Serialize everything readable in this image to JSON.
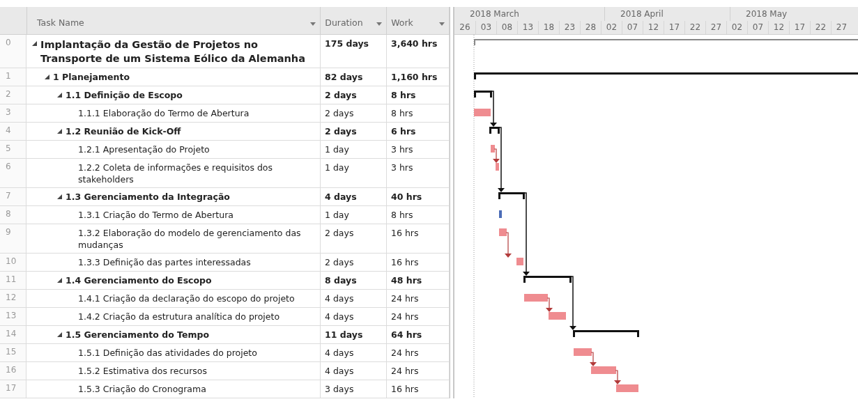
{
  "columns": [
    {
      "label": "Task Name"
    },
    {
      "label": "Duration"
    },
    {
      "label": "Work"
    }
  ],
  "timescale": {
    "months": [
      "2018 March",
      "2018 April",
      "2018 May"
    ],
    "days": [
      "26",
      "03",
      "08",
      "13",
      "18",
      "23",
      "28",
      "02",
      "07",
      "12",
      "17",
      "22",
      "27",
      "02",
      "07",
      "12",
      "17",
      "22",
      "27"
    ]
  },
  "tasks": [
    {
      "id": "0",
      "name": "Implantação da Gestão de Projetos no Transporte de um Sistema Eólico da Alemanha",
      "duration": "175 days",
      "work": "3,640 hrs",
      "kind": "project",
      "expanded": true,
      "children": [
        {
          "id": "1",
          "name": "1 Planejamento",
          "duration": "82 days",
          "work": "1,160 hrs",
          "kind": "summary",
          "expanded": true,
          "children": [
            {
              "id": "2",
              "name": "1.1 Definição de Escopo",
              "duration": "2 days",
              "work": "8 hrs",
              "kind": "summary",
              "expanded": true,
              "children": [
                {
                  "id": "3",
                  "name": "1.1.1 Elaboração do Termo de Abertura",
                  "duration": "2 days",
                  "work": "8 hrs",
                  "kind": "task",
                  "critical": true
                }
              ]
            },
            {
              "id": "4",
              "name": "1.2 Reunião de Kick-Off",
              "duration": "2 days",
              "work": "6 hrs",
              "kind": "summary",
              "expanded": true,
              "children": [
                {
                  "id": "5",
                  "name": "1.2.1 Apresentação do Projeto",
                  "duration": "1 day",
                  "work": "3 hrs",
                  "kind": "task",
                  "critical": true
                },
                {
                  "id": "6",
                  "name": "1.2.2 Coleta de informações e requisitos dos stakeholders",
                  "duration": "1 day",
                  "work": "3 hrs",
                  "kind": "task",
                  "critical": true
                }
              ]
            },
            {
              "id": "7",
              "name": "1.3 Gerenciamento da Integração",
              "duration": "4 days",
              "work": "40 hrs",
              "kind": "summary",
              "expanded": true,
              "children": [
                {
                  "id": "8",
                  "name": "1.3.1 Criação do Termo de Abertura",
                  "duration": "1 day",
                  "work": "8 hrs",
                  "kind": "task",
                  "critical": false
                },
                {
                  "id": "9",
                  "name": "1.3.2 Elaboração do modelo de gerenciamento das mudanças",
                  "duration": "2 days",
                  "work": "16 hrs",
                  "kind": "task",
                  "critical": true
                },
                {
                  "id": "10",
                  "name": "1.3.3 Definição das partes interessadas",
                  "duration": "2 days",
                  "work": "16 hrs",
                  "kind": "task",
                  "critical": true
                }
              ]
            },
            {
              "id": "11",
              "name": "1.4 Gerenciamento do Escopo",
              "duration": "8 days",
              "work": "48 hrs",
              "kind": "summary",
              "expanded": true,
              "children": [
                {
                  "id": "12",
                  "name": "1.4.1 Criação da declaração do escopo do projeto",
                  "duration": "4 days",
                  "work": "24 hrs",
                  "kind": "task",
                  "critical": true
                },
                {
                  "id": "13",
                  "name": "1.4.2 Criação da estrutura analítica do projeto",
                  "duration": "4 days",
                  "work": "24 hrs",
                  "kind": "task",
                  "critical": true
                }
              ]
            },
            {
              "id": "14",
              "name": "1.5 Gerenciamento do Tempo",
              "duration": "11 days",
              "work": "64 hrs",
              "kind": "summary",
              "expanded": true,
              "children": [
                {
                  "id": "15",
                  "name": "1.5.1 Definição das atividades do projeto",
                  "duration": "4 days",
                  "work": "24 hrs",
                  "kind": "task",
                  "critical": true
                },
                {
                  "id": "16",
                  "name": "1.5.2 Estimativa dos recursos",
                  "duration": "4 days",
                  "work": "24 hrs",
                  "kind": "task",
                  "critical": true
                },
                {
                  "id": "17",
                  "name": "1.5.3 Criação do Cronograma",
                  "duration": "3 days",
                  "work": "16 hrs",
                  "kind": "task",
                  "critical": true
                }
              ]
            }
          ]
        }
      ]
    }
  ]
}
